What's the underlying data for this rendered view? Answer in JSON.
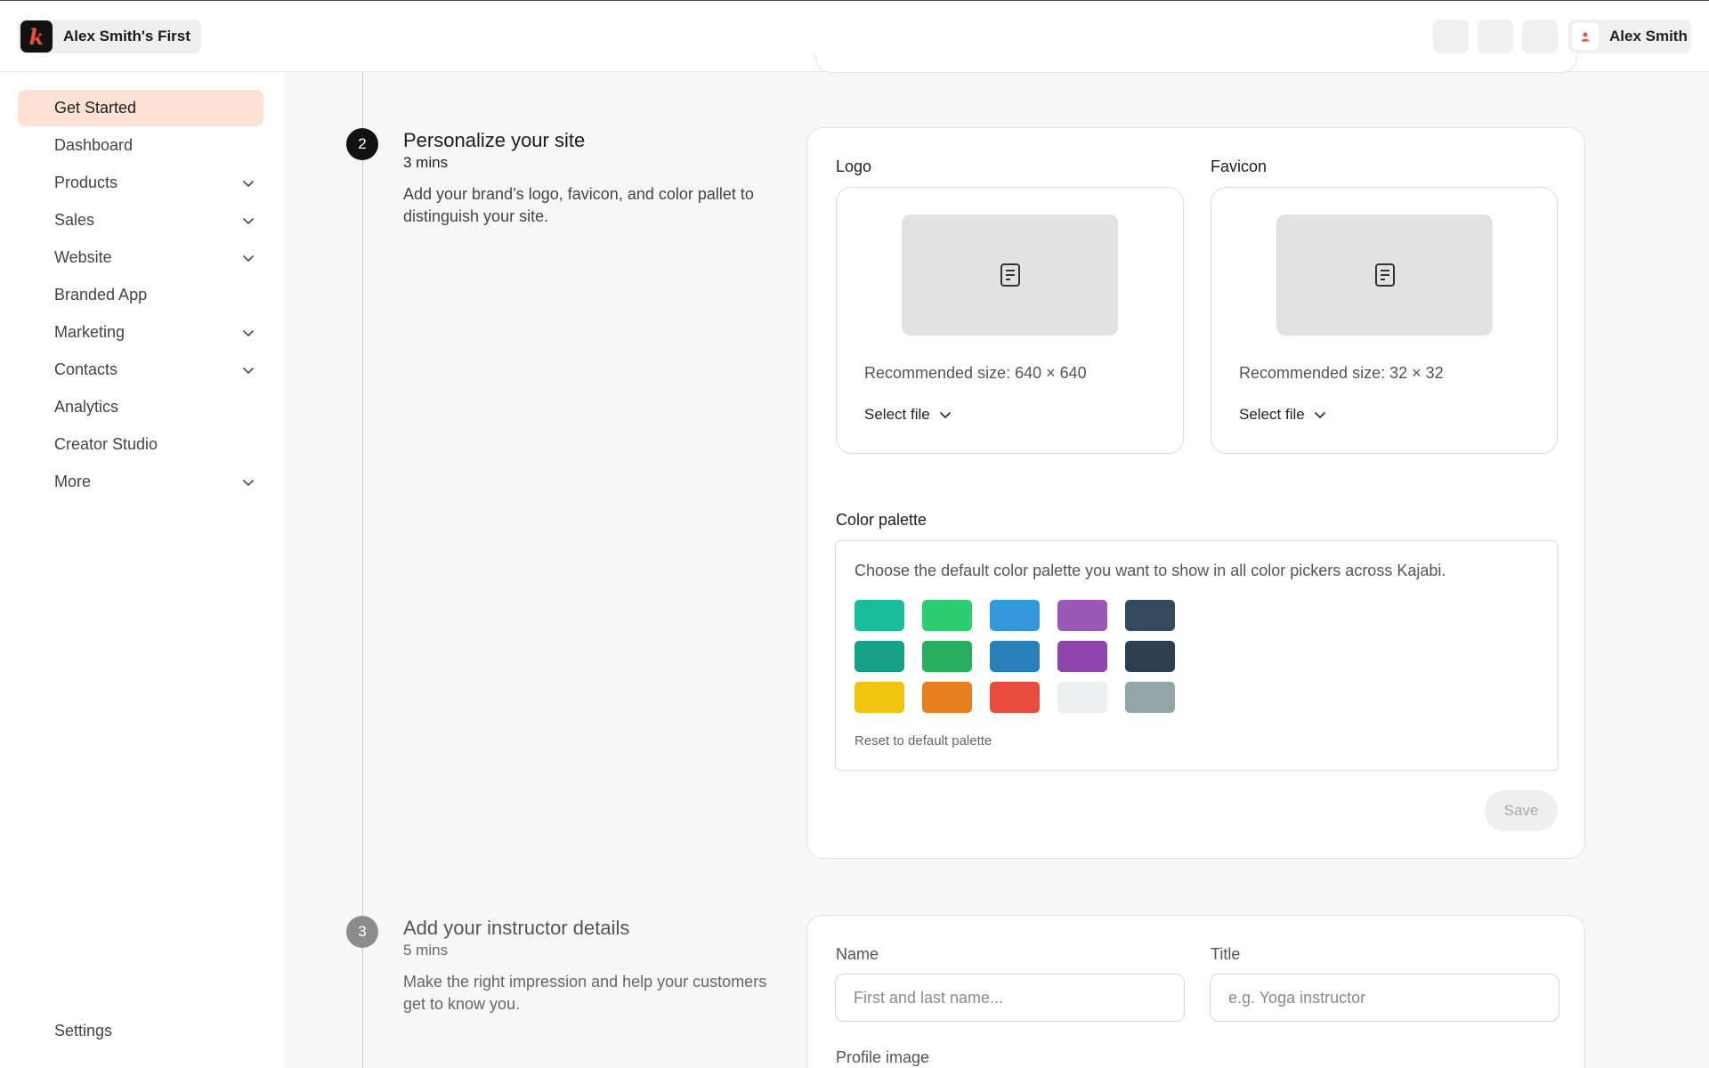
{
  "topbar": {
    "site_name": "Alex Smith's First",
    "user_name": "Alex Smith"
  },
  "sidebar": {
    "items": [
      {
        "label": "Get Started",
        "active": true,
        "chevron": false
      },
      {
        "label": "Dashboard",
        "chevron": false
      },
      {
        "label": "Products",
        "chevron": true
      },
      {
        "label": "Sales",
        "chevron": true
      },
      {
        "label": "Website",
        "chevron": true
      },
      {
        "label": "Branded App",
        "chevron": false
      },
      {
        "label": "Marketing",
        "chevron": true
      },
      {
        "label": "Contacts",
        "chevron": true
      },
      {
        "label": "Analytics",
        "chevron": false
      },
      {
        "label": "Creator Studio",
        "chevron": false
      },
      {
        "label": "More",
        "chevron": true
      }
    ],
    "settings_label": "Settings"
  },
  "steps": {
    "personalize": {
      "number": "2",
      "title": "Personalize your site",
      "time": "3 mins",
      "description": "Add your brand’s logo, favicon, and color pallet to distinguish your site.",
      "logo": {
        "label": "Logo",
        "recommended": "Recommended size: 640 × 640",
        "select": "Select file"
      },
      "favicon": {
        "label": "Favicon",
        "recommended": "Recommended size: 32 × 32",
        "select": "Select file"
      },
      "palette": {
        "label": "Color palette",
        "description": "Choose the default color palette you want to show in all color pickers across Kajabi.",
        "colors": [
          [
            "#1abc9c",
            "#2ecc71",
            "#3498db",
            "#9b59b6",
            "#34495e"
          ],
          [
            "#16a085",
            "#27ae60",
            "#2980b9",
            "#8e44ad",
            "#2c3e50"
          ],
          [
            "#f1c40f",
            "#e67e22",
            "#e74c3c",
            "#ecf0f1",
            "#95a5a6"
          ]
        ],
        "reset": "Reset to default palette"
      },
      "save": "Save"
    },
    "instructor": {
      "number": "3",
      "title": "Add your instructor details",
      "time": "5 mins",
      "description": "Make the right impression and help your customers get to know you.",
      "name_label": "Name",
      "name_placeholder": "First and last name...",
      "title_label": "Title",
      "title_placeholder": "e.g. Yoga instructor",
      "profile_image_label": "Profile image"
    }
  }
}
